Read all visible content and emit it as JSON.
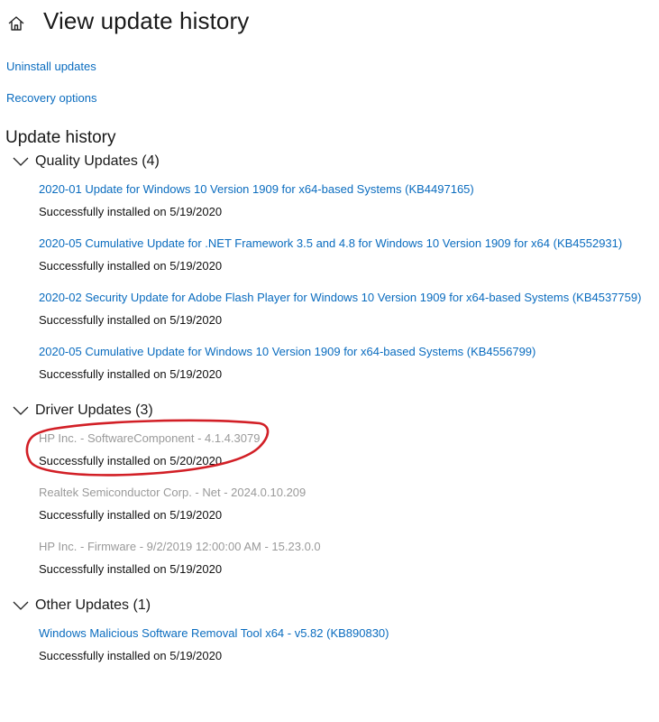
{
  "page": {
    "title": "View update history"
  },
  "links": {
    "uninstall": "Uninstall updates",
    "recovery": "Recovery options"
  },
  "section_title": "Update history",
  "groups": [
    {
      "label": "Quality Updates (4)",
      "items": [
        {
          "title": "2020-01 Update for Windows 10 Version 1909 for x64-based Systems (KB4497165)",
          "status": "Successfully installed on 5/19/2020"
        },
        {
          "title": "2020-05 Cumulative Update for .NET Framework 3.5 and 4.8 for Windows 10 Version 1909 for x64 (KB4552931)",
          "status": "Successfully installed on 5/19/2020"
        },
        {
          "title": "2020-02 Security Update for Adobe Flash Player for Windows 10 Version 1909 for x64-based Systems (KB4537759)",
          "status": "Successfully installed on 5/19/2020"
        },
        {
          "title": "2020-05 Cumulative Update for Windows 10 Version 1909 for x64-based Systems (KB4556799)",
          "status": "Successfully installed on 5/19/2020"
        }
      ]
    },
    {
      "label": "Driver Updates (3)",
      "items": [
        {
          "title": "HP Inc. - SoftwareComponent - 4.1.4.3079",
          "status": "Successfully installed on 5/20/2020"
        },
        {
          "title": "Realtek Semiconductor Corp. - Net - 2024.0.10.209",
          "status": "Successfully installed on 5/19/2020"
        },
        {
          "title": "HP Inc. - Firmware - 9/2/2019 12:00:00 AM - 15.23.0.0",
          "status": "Successfully installed on 5/19/2020"
        }
      ]
    },
    {
      "label": "Other Updates (1)",
      "items": [
        {
          "title": "Windows Malicious Software Removal Tool x64 - v5.82 (KB890830)",
          "status": "Successfully installed on 5/19/2020"
        }
      ]
    }
  ],
  "colors": {
    "link": "#0a6cbf",
    "disabled_text": "#9a9a9a",
    "annotation": "#d21f26"
  },
  "icons": {
    "home": "home-icon",
    "expand": "chevron-down-icon"
  }
}
